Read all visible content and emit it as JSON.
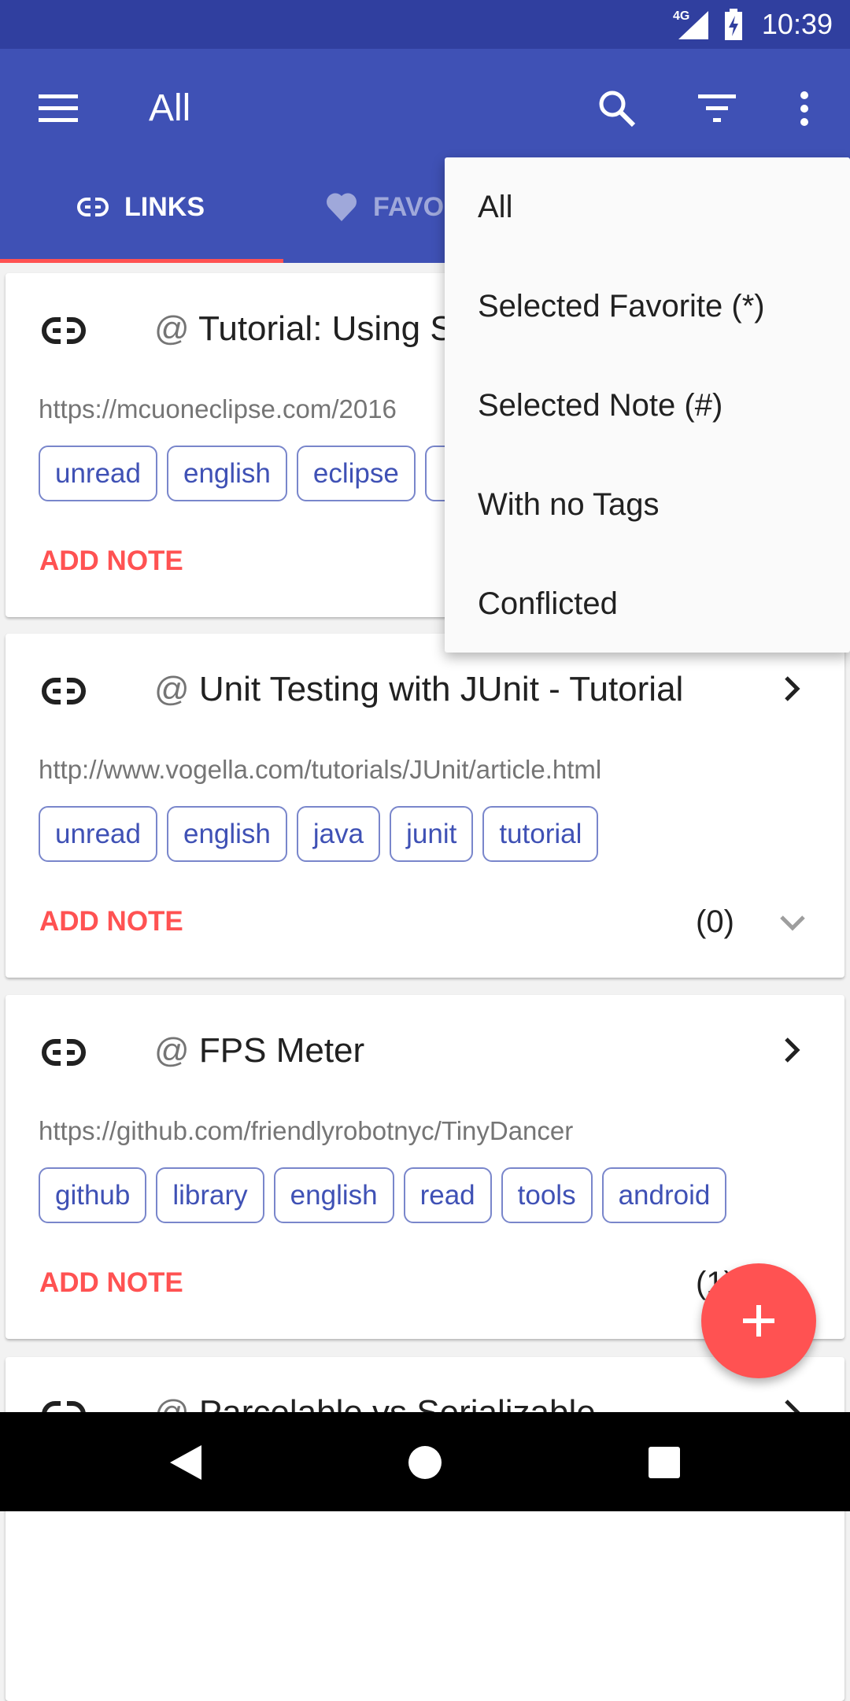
{
  "status_bar": {
    "network": "4G",
    "time": "10:39"
  },
  "toolbar": {
    "title": "All",
    "icons": [
      "menu-icon",
      "search-icon",
      "filter-icon",
      "more-vert-icon"
    ]
  },
  "tabs": [
    {
      "label": "LINKS",
      "icon": "link-icon",
      "active": true
    },
    {
      "label": "FAVO",
      "icon": "heart-icon",
      "active": false
    }
  ],
  "colors": {
    "primary": "#3F51B5",
    "primary_dark": "#303F9F",
    "accent": "#FF5252"
  },
  "cards": [
    {
      "title": "Tutorial: Using S",
      "url": "https://mcuoneclipse.com/2016",
      "tags": [
        "unread",
        "english",
        "eclipse",
        ""
      ],
      "add_note": "ADD NOTE",
      "count": ""
    },
    {
      "title": "Unit Testing with JUnit - Tutorial",
      "url": "http://www.vogella.com/tutorials/JUnit/article.html",
      "tags": [
        "unread",
        "english",
        "java",
        "junit",
        "tutorial"
      ],
      "add_note": "ADD NOTE",
      "count": "(0)"
    },
    {
      "title": "FPS Meter",
      "url": "https://github.com/friendlyrobotnyc/TinyDancer",
      "tags": [
        "github",
        "library",
        "english",
        "read",
        "tools",
        "android"
      ],
      "add_note": "ADD NOTE",
      "count": "(1)"
    },
    {
      "title": "Parcelable vs Serializable"
    }
  ],
  "at_sign": "@",
  "menu": {
    "items": [
      "All",
      "Selected Favorite (*)",
      "Selected Note (#)",
      "With no Tags",
      "Conflicted"
    ]
  }
}
